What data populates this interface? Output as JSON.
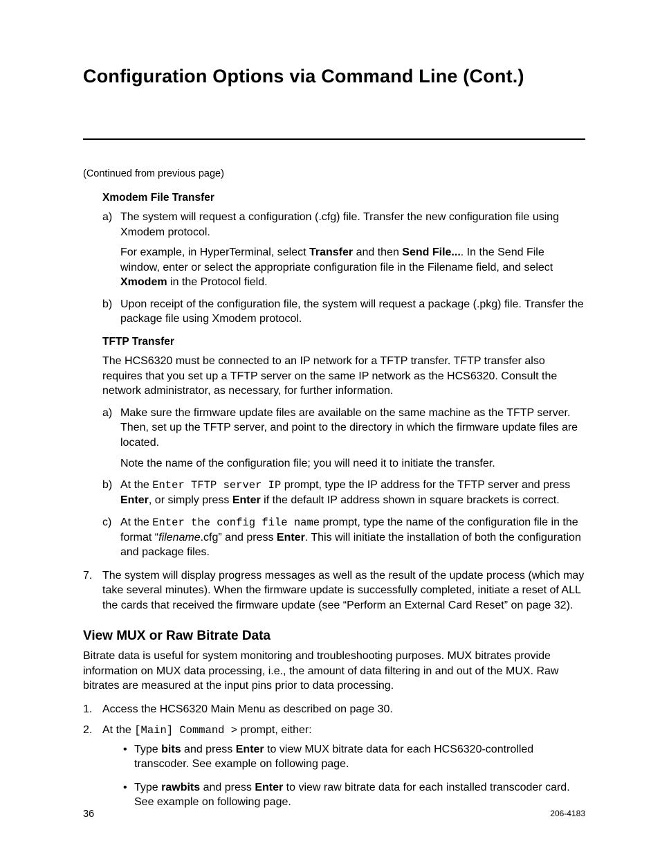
{
  "title": "Configuration Options via Command Line (Cont.)",
  "continued": "(Continued from previous page)",
  "xmodem": {
    "heading": "Xmodem File Transfer",
    "a": {
      "marker": "a)",
      "t1": "The system will request a configuration (.cfg) file. Transfer the new configuration file using Xmodem protocol.",
      "t2a": "For example, in HyperTerminal, select ",
      "t2b": "Transfer",
      "t2c": " and then ",
      "t2d": "Send File...",
      "t2e": ". In the Send File window, enter or select the appropriate configuration file in the Filename field, and select ",
      "t2f": "Xmodem",
      "t2g": " in the Protocol field."
    },
    "b": {
      "marker": "b)",
      "t1": "Upon receipt of the configuration file, the system will request a package (.pkg) file. Transfer the package file using Xmodem protocol."
    }
  },
  "tftp": {
    "heading": "TFTP Transfer",
    "intro": "The HCS6320 must be connected to an IP network for a TFTP transfer. TFTP transfer also requires that you set up a TFTP server on the same IP network as the HCS6320. Consult the network administrator, as necessary, for further information.",
    "a": {
      "marker": "a)",
      "t1": "Make sure the firmware update files are available on the same machine as the TFTP server. Then, set up the TFTP server, and point to the directory in which the firmware update files are located.",
      "t2": "Note the name of the configuration file; you will need it to initiate the transfer."
    },
    "b": {
      "marker": "b)",
      "t1": "At the ",
      "prompt": "Enter TFTP server IP",
      "t2": " prompt, type the IP address for the TFTP server and press ",
      "enter1": "Enter",
      "t3": ", or simply press ",
      "enter2": "Enter",
      "t4": " if the default IP address shown in square brackets is correct."
    },
    "c": {
      "marker": "c)",
      "t1": "At the ",
      "prompt": "Enter the config file name",
      "t2": " prompt, type the name of the configuration file in the format “",
      "fn": "filename",
      "t3": ".cfg” and press ",
      "enter": "Enter",
      "t4": ". This will initiate the installation of both the configuration and package files."
    }
  },
  "step7": {
    "marker": "7.",
    "text": "The system will display progress messages as well as the result of the update process (which may take several minutes). When the firmware update is successfully completed, initiate a reset of ALL the cards that received the firmware update (see “Perform an External Card Reset” on page 32)."
  },
  "bitrate": {
    "heading": "View MUX or Raw Bitrate Data",
    "intro": "Bitrate data is useful for system monitoring and troubleshooting purposes. MUX bitrates provide information on MUX data processing, i.e., the amount of data filtering in and out of the MUX. Raw bitrates are measured at the input pins prior to data processing.",
    "s1": {
      "marker": "1.",
      "text": "Access the HCS6320 Main Menu as described on page 30."
    },
    "s2": {
      "marker": "2.",
      "t1": "At the ",
      "prompt": "[Main] Command >",
      "t2": " prompt, either:",
      "b1a": "Type ",
      "b1b": "bits",
      "b1c": " and press ",
      "b1d": "Enter",
      "b1e": " to view MUX bitrate data for each HCS6320-controlled transcoder. See example on following page.",
      "b2a": "Type ",
      "b2b": "rawbits",
      "b2c": " and press ",
      "b2d": "Enter",
      "b2e": " to view raw bitrate data for each installed transcoder card. See example on following page."
    }
  },
  "footer": {
    "page": "36",
    "docnum": "206-4183"
  }
}
